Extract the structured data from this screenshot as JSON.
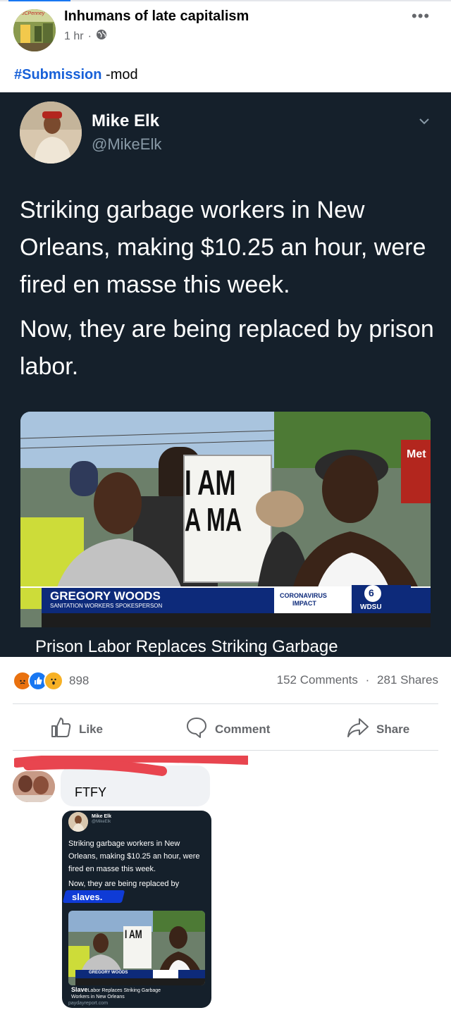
{
  "group": {
    "name": "Inhumans of late capitalism",
    "time": "1 hr",
    "separator": "·",
    "avatar_text": "JCPenney"
  },
  "post": {
    "hashtag": "#Submission",
    "suffix": " -mod"
  },
  "tweet": {
    "name": "Mike Elk",
    "handle": "@MikeElk",
    "para1": "Striking garbage workers in New Orleans, making $10.25 an hour, were fired en masse this week.",
    "para2": "Now, they are being replaced by prison labor.",
    "sign_line1": "I AM",
    "sign_line2": "A MA",
    "lower_third_name": "GREGORY WOODS",
    "lower_third_title": "SANITATION WORKERS SPOKESPERSON",
    "tag_line1": "CORONAVIRUS",
    "tag_line2": "IMPACT",
    "station": "WDSU",
    "channel": "6",
    "sign_right": "Met",
    "link_title": "Prison Labor Replaces Striking Garbage"
  },
  "engagement": {
    "reaction_count": "898",
    "comments": "152 Comments",
    "separator": "·",
    "shares": "281 Shares"
  },
  "actions": {
    "like": "Like",
    "comment": "Comment",
    "share": "Share"
  },
  "comment": {
    "text": "FTFY",
    "mini_tweet": {
      "name": "Mike Elk",
      "handle": "@MikeElk",
      "para1": "Striking garbage workers in New Orleans, making $10.25 an hour, were fired en masse this week.",
      "para2": "Now, they are being replaced by",
      "highlight": "slaves.",
      "caption_bold": "Slave",
      "caption_rest": "Labor Replaces Striking Garbage",
      "caption_line2": "Workers in New Orleans",
      "source": "paydayreport.com",
      "lower_third_name": "GREGORY WOODS"
    }
  },
  "colors": {
    "accent": "#1877f2",
    "tweet_bg": "#15202b",
    "hashtag": "#1760d8",
    "muted": "#65676b",
    "red_scribble": "#e8454f"
  }
}
